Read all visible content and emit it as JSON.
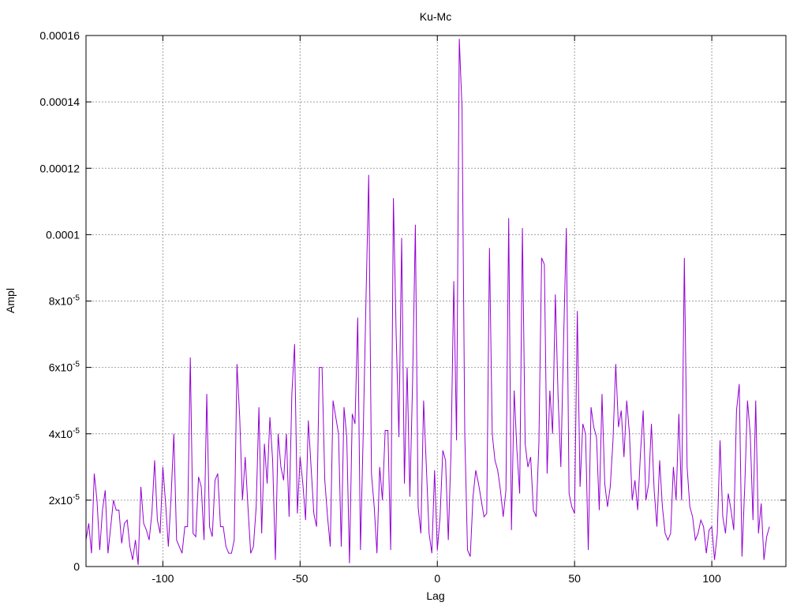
{
  "chart_data": {
    "type": "line",
    "title": "Ku-Mc",
    "xlabel": "Lag",
    "ylabel": "Ampl",
    "xlim": [
      -128,
      127
    ],
    "ylim": [
      0,
      0.00016
    ],
    "x_ticks": [
      -100,
      -50,
      0,
      50,
      100
    ],
    "x_tick_labels": [
      "-100",
      "-50",
      "0",
      "50",
      "100"
    ],
    "y_ticks": [
      0,
      2e-05,
      4e-05,
      6e-05,
      8e-05,
      0.0001,
      0.00012,
      0.00014,
      0.00016
    ],
    "y_tick_labels": [
      {
        "text": "0",
        "exp": ""
      },
      {
        "text": "2x10",
        "exp": "-5"
      },
      {
        "text": "4x10",
        "exp": "-5"
      },
      {
        "text": "6x10",
        "exp": "-5"
      },
      {
        "text": "8x10",
        "exp": "-5"
      },
      {
        "text": "0.0001",
        "exp": ""
      },
      {
        "text": "0.00012",
        "exp": ""
      },
      {
        "text": "0.00014",
        "exp": ""
      },
      {
        "text": "0.00016",
        "exp": ""
      }
    ],
    "grid": true,
    "line_color": "#9400d3",
    "series": [
      {
        "x_start": -128,
        "x_step": 1,
        "values": [
          8e-06,
          1.3e-05,
          4e-06,
          2.8e-05,
          2e-05,
          5e-06,
          1.7e-05,
          2.3e-05,
          4e-06,
          1.2e-05,
          2e-05,
          1.7e-05,
          1.7e-05,
          7e-06,
          1.3e-05,
          1.4e-05,
          6e-06,
          2e-06,
          8e-06,
          5e-07,
          2.4e-05,
          1.3e-05,
          1.1e-05,
          8e-06,
          1.6e-05,
          3.2e-05,
          1.4e-05,
          1e-05,
          3e-05,
          1.9e-05,
          6e-06,
          2.1e-05,
          4e-05,
          8e-06,
          6e-06,
          4e-06,
          1.2e-05,
          1.2e-05,
          6.3e-05,
          1e-05,
          9e-06,
          2.7e-05,
          2.4e-05,
          8e-06,
          5.2e-05,
          1.2e-05,
          9e-06,
          2.6e-05,
          2.8e-05,
          1.2e-05,
          1.2e-05,
          6e-06,
          4e-06,
          4e-06,
          8e-06,
          6.1e-05,
          4.5e-05,
          2e-05,
          3.3e-05,
          1.8e-05,
          4e-06,
          6e-06,
          1.8e-05,
          4.8e-05,
          1e-05,
          3.7e-05,
          2.5e-05,
          4.5e-05,
          3.2e-05,
          2e-06,
          4e-05,
          3e-05,
          2.6e-05,
          4e-05,
          1.5e-05,
          5.2e-05,
          6.7e-05,
          1.6e-05,
          3.3e-05,
          2.5e-05,
          1.4e-05,
          4.4e-05,
          3e-05,
          1.6e-05,
          1.2e-05,
          6e-05,
          6e-05,
          2.6e-05,
          1.5e-05,
          6e-06,
          5e-05,
          4.5e-05,
          4e-05,
          6e-06,
          4.8e-05,
          3.9e-05,
          1e-06,
          4.6e-05,
          4.3e-05,
          7.5e-05,
          5e-06,
          4e-05,
          8e-05,
          0.000118,
          2.8e-05,
          1.8e-05,
          4e-06,
          3e-05,
          2e-05,
          4.1e-05,
          4.1e-05,
          5e-06,
          0.000111,
          7e-05,
          3.9e-05,
          9.9e-05,
          2.5e-05,
          6e-05,
          2.1e-05,
          5.6e-05,
          0.000103,
          1.8e-05,
          1e-05,
          5e-05,
          3e-05,
          1e-05,
          4e-06,
          2.9e-05,
          5e-06,
          1.5e-05,
          3.5e-05,
          3.2e-05,
          8e-06,
          3.5e-05,
          8.6e-05,
          3.8e-05,
          0.000159,
          0.000138,
          4e-05,
          5e-06,
          3e-06,
          2.1e-05,
          2.9e-05,
          2.5e-05,
          2e-05,
          1.5e-05,
          1.6e-05,
          9.6e-05,
          4e-05,
          3.2e-05,
          2.9e-05,
          2.3e-05,
          1.5e-05,
          2.3e-05,
          0.000105,
          1.1e-05,
          5.3e-05,
          3.5e-05,
          2.2e-05,
          0.000102,
          3.7e-05,
          3e-05,
          3.3e-05,
          1.7e-05,
          1.5e-05,
          3.7e-05,
          9.3e-05,
          9.1e-05,
          2.8e-05,
          5.3e-05,
          4e-05,
          8.2e-05,
          5.1e-05,
          3e-05,
          6.8e-05,
          0.000102,
          2.2e-05,
          1.8e-05,
          1.6e-05,
          7.7e-05,
          2.4e-05,
          4.3e-05,
          4e-05,
          5e-06,
          4.8e-05,
          4.2e-05,
          3.9e-05,
          1.7e-05,
          5.2e-05,
          2.5e-05,
          1.8e-05,
          2.4e-05,
          3.8e-05,
          6.1e-05,
          4.2e-05,
          4.7e-05,
          3.3e-05,
          5e-05,
          4e-05,
          2e-05,
          2.6e-05,
          1.7e-05,
          3.4e-05,
          4.7e-05,
          2e-05,
          2.5e-05,
          4.3e-05,
          2.3e-05,
          1.2e-05,
          3.2e-05,
          1.8e-05,
          1e-05,
          8e-06,
          1e-05,
          3e-05,
          2e-05,
          4.6e-05,
          2e-05,
          9.3e-05,
          3e-05,
          1.8e-05,
          1.5e-05,
          8e-06,
          1e-05,
          1.4e-05,
          1.2e-05,
          4e-06,
          1.1e-05,
          1.2e-05,
          2e-06,
          1e-05,
          3.8e-05,
          1.5e-05,
          1e-05,
          2.2e-05,
          1.7e-05,
          1.1e-05,
          4.7e-05,
          5.5e-05,
          3e-06,
          2.4e-05,
          5e-05,
          4e-05,
          1.4e-05,
          5e-05,
          1e-05,
          1.9e-05,
          2e-06,
          9e-06,
          1.2e-05
        ]
      }
    ]
  }
}
